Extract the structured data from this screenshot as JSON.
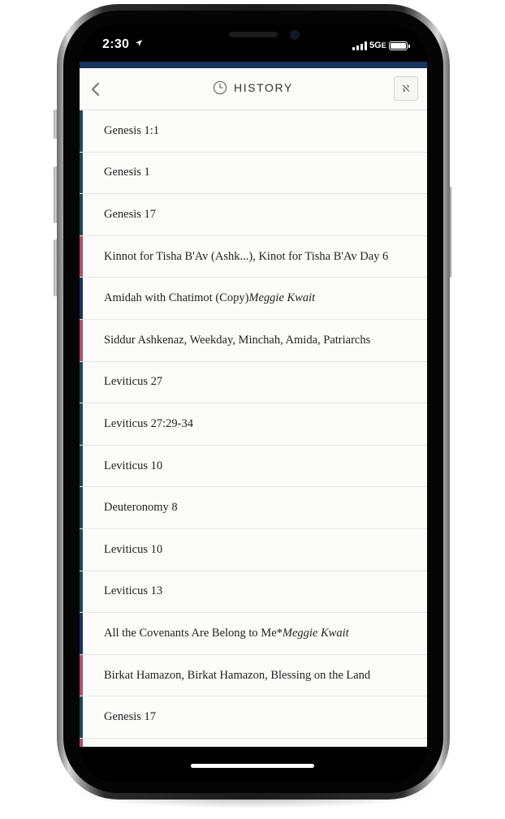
{
  "status_bar": {
    "time": "2:30",
    "network": "5G",
    "network_suffix": "E"
  },
  "header": {
    "title": "HISTORY",
    "back_icon": "chevron-left-icon",
    "clock_icon": "clock-icon",
    "language_toggle_label": "ℵ"
  },
  "colors": {
    "tanakh": "#1c4a5a",
    "liturgy": "#b14d68",
    "sheet": "#18345d",
    "background": "#fbfbfa"
  },
  "history_items": [
    {
      "title": "Genesis 1:1",
      "author": "",
      "category": "tanakh"
    },
    {
      "title": "Genesis 1",
      "author": "",
      "category": "tanakh"
    },
    {
      "title": "Genesis 17",
      "author": "",
      "category": "tanakh"
    },
    {
      "title": "Kinnot for Tisha B'Av (Ashk...), Kinot for Tisha B'Av Day 6",
      "author": "",
      "category": "liturgy"
    },
    {
      "title": "Amidah with Chatimot (Copy)",
      "author": "Meggie Kwait",
      "category": "sheet"
    },
    {
      "title": "Siddur Ashkenaz, Weekday, Minchah, Amida, Patriarchs",
      "author": "",
      "category": "liturgy"
    },
    {
      "title": "Leviticus 27",
      "author": "",
      "category": "tanakh"
    },
    {
      "title": "Leviticus 27:29-34",
      "author": "",
      "category": "tanakh"
    },
    {
      "title": "Leviticus 10",
      "author": "",
      "category": "tanakh"
    },
    {
      "title": "Deuteronomy 8",
      "author": "",
      "category": "tanakh"
    },
    {
      "title": "Leviticus 10",
      "author": "",
      "category": "tanakh"
    },
    {
      "title": "Leviticus 13",
      "author": "",
      "category": "tanakh"
    },
    {
      "title": "All the Covenants Are Belong to Me* ",
      "author": "Meggie Kwait",
      "category": "sheet"
    },
    {
      "title": "Birkat Hamazon, Birkat Hamazon, Blessing on the Land",
      "author": "",
      "category": "liturgy"
    },
    {
      "title": "Genesis 17",
      "author": "",
      "category": "tanakh"
    }
  ]
}
